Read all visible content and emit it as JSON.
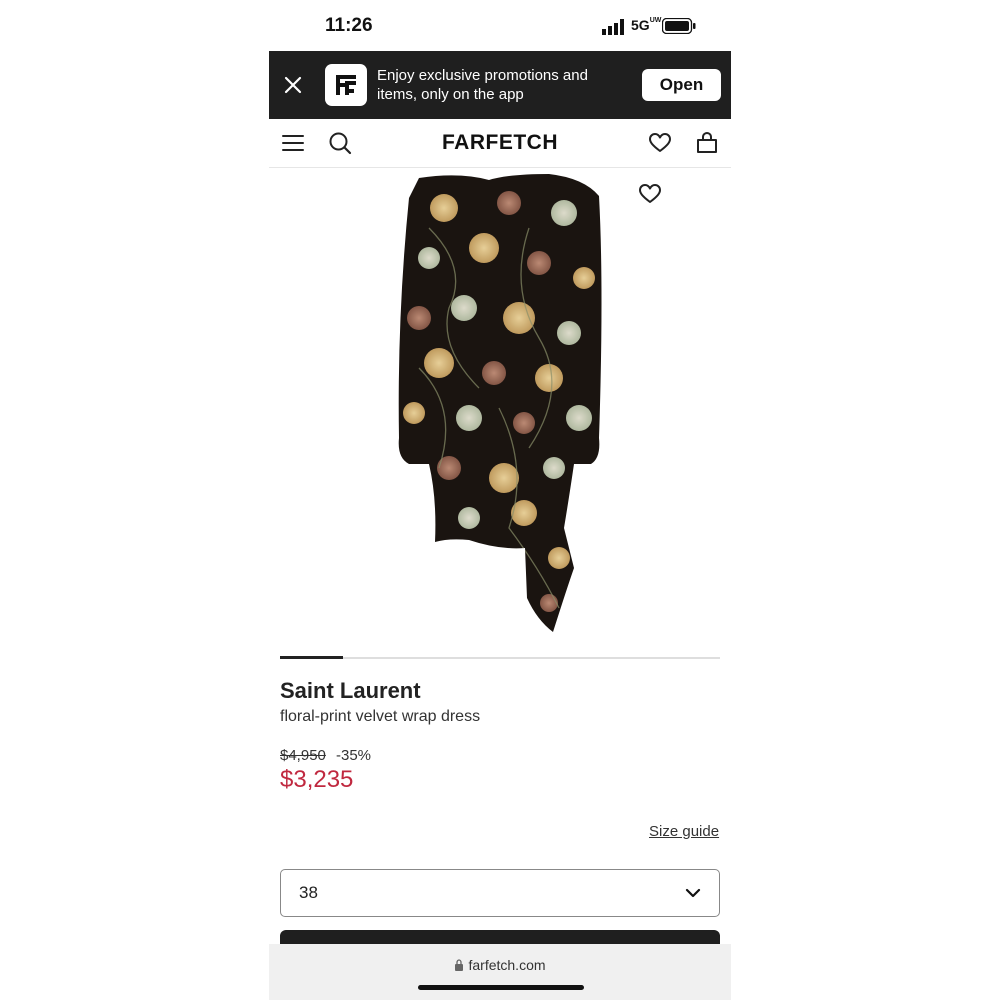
{
  "status_bar": {
    "time": "11:26",
    "network": "5G",
    "network_sup": "UW"
  },
  "app_banner": {
    "text": "Enjoy exclusive promotions and items, only on the app",
    "open_label": "Open",
    "logo_text": "FF"
  },
  "header": {
    "brand": "FARFETCH"
  },
  "product": {
    "brand": "Saint Laurent",
    "description": "floral-print velvet wrap dress",
    "original_price": "$4,950",
    "discount": "-35%",
    "sale_price": "$3,235",
    "image_count_active_fraction": 0.143
  },
  "size_guide_label": "Size guide",
  "size_select": {
    "selected": "38"
  },
  "url_bar": {
    "url": "farfetch.com"
  },
  "colors": {
    "banner_bg": "#1f1f1f",
    "sale_red": "#c0283f",
    "dress_black": "#1a1410"
  },
  "icons": [
    "signal-icon",
    "battery-icon",
    "close-icon",
    "farfetch-app-logo",
    "menu-icon",
    "search-icon",
    "heart-icon",
    "bag-icon",
    "chevron-down-icon",
    "lock-icon"
  ]
}
